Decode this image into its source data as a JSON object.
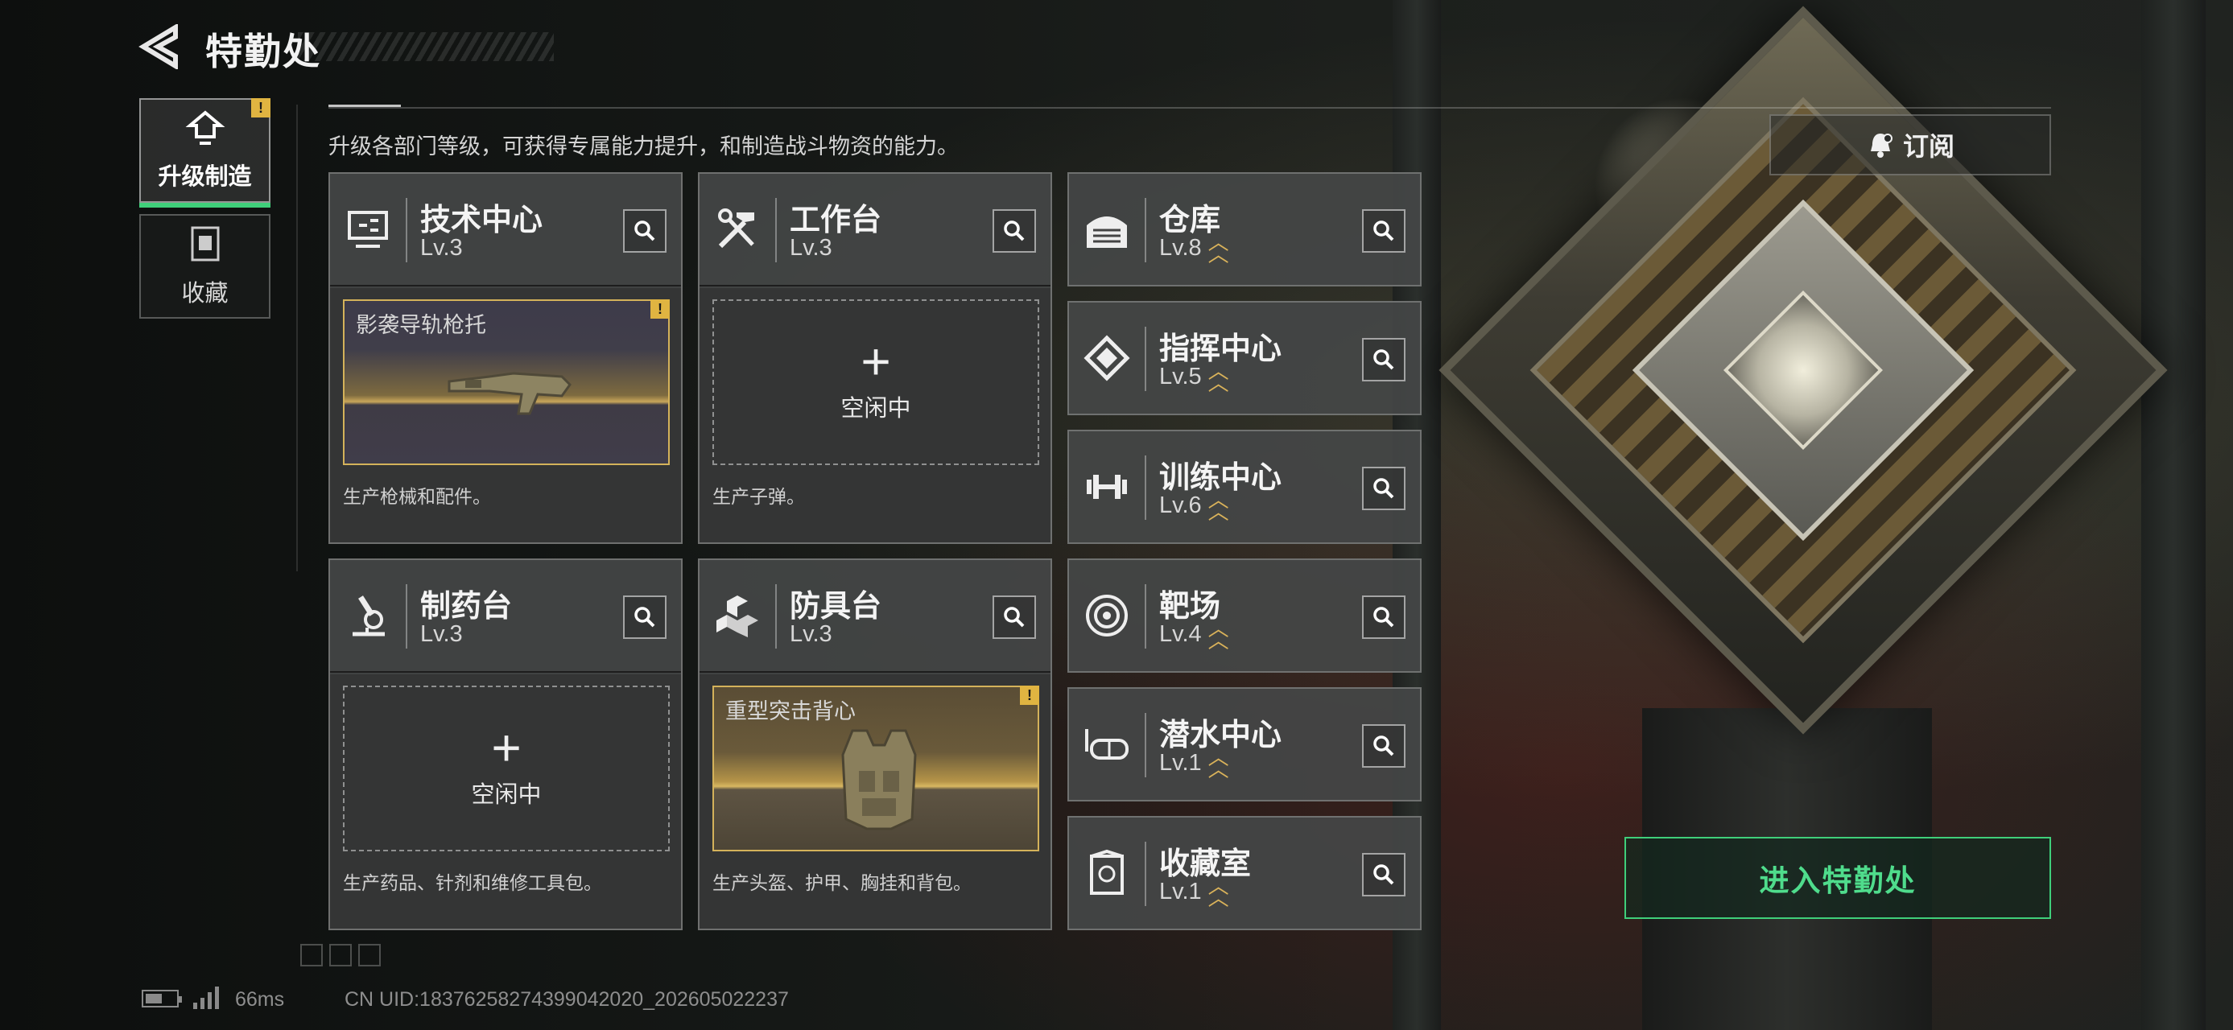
{
  "header": {
    "title": "特勤处",
    "description": "升级各部门等级，可获得专属能力提升，和制造战斗物资的能力。"
  },
  "nav": [
    {
      "label": "升级制造",
      "icon": "upgrade-icon",
      "active": true,
      "alert": "!"
    },
    {
      "label": "收藏",
      "icon": "collection-icon",
      "active": false
    }
  ],
  "facilities": {
    "tech_center": {
      "name": "技术中心",
      "level": "Lv.3",
      "icon": "monitor-tools-icon",
      "slot_item": "影袭导轨枪托",
      "alert": "!",
      "desc": "生产枪械和配件。"
    },
    "workbench": {
      "name": "工作台",
      "level": "Lv.3",
      "icon": "hammer-wrench-icon",
      "slot_idle": "空闲中",
      "desc": "生产子弹。"
    },
    "pharmacy": {
      "name": "制药台",
      "level": "Lv.3",
      "icon": "microscope-icon",
      "slot_idle": "空闲中",
      "desc": "生产药品、针剂和维修工具包。"
    },
    "armor_bench": {
      "name": "防具台",
      "level": "Lv.3",
      "icon": "armor-blocks-icon",
      "slot_item": "重型突击背心",
      "alert": "!",
      "desc": "生产头盔、护甲、胸挂和背包。"
    },
    "warehouse": {
      "name": "仓库",
      "level": "Lv.8",
      "icon": "warehouse-icon"
    },
    "command": {
      "name": "指挥中心",
      "level": "Lv.5",
      "icon": "chip-icon"
    },
    "training": {
      "name": "训练中心",
      "level": "Lv.6",
      "icon": "dumbbell-icon"
    },
    "range": {
      "name": "靶场",
      "level": "Lv.4",
      "icon": "target-icon"
    },
    "diving": {
      "name": "潜水中心",
      "level": "Lv.1",
      "icon": "diving-mask-icon"
    },
    "collection": {
      "name": "收藏室",
      "level": "Lv.1",
      "icon": "trophy-case-icon"
    }
  },
  "buttons": {
    "subscribe": "订阅",
    "enter": "进入特勤处"
  },
  "status": {
    "ping": "66ms",
    "uid": "CN UID:1837625827439904202​0_202605022237"
  },
  "colors": {
    "accent_green": "#3fcf7a",
    "alert_yellow": "#e0b441",
    "upgrade_gold": "#d9b25a"
  }
}
